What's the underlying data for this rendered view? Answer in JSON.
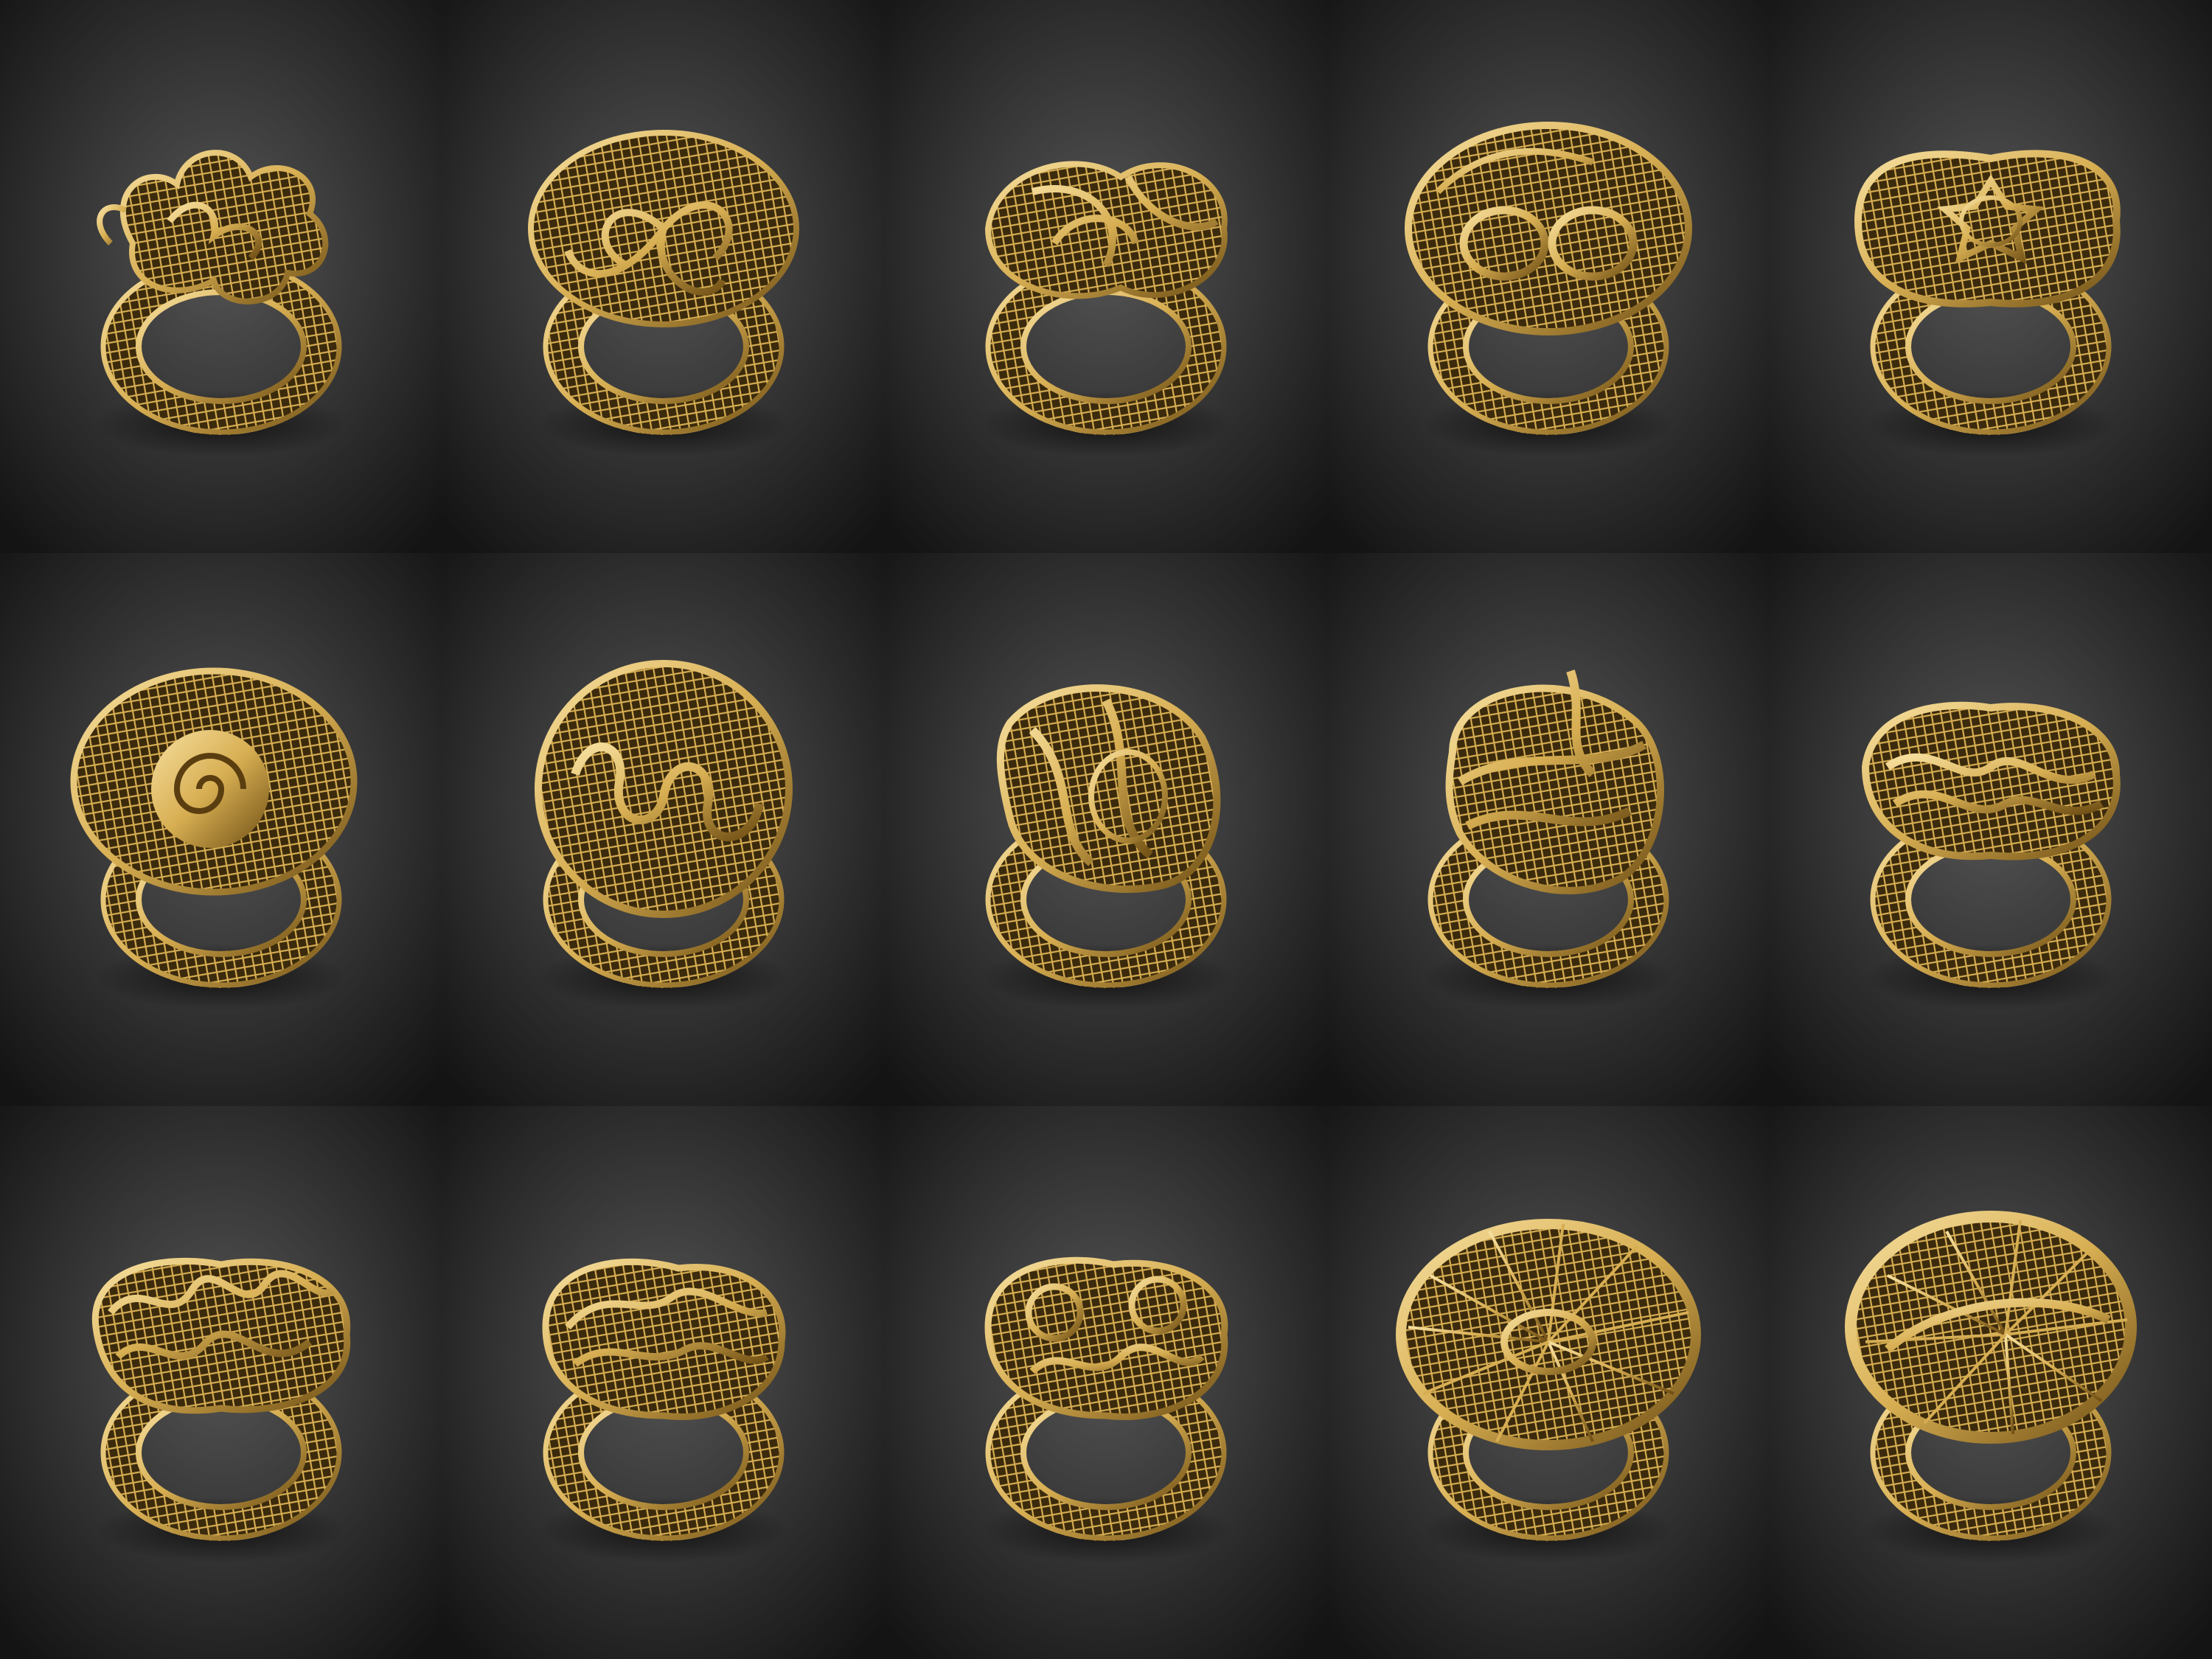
{
  "scene": {
    "background_light": "#555555",
    "background_dark": "#141414",
    "gold_light": "#f7e0a0",
    "gold_mid": "#d7ae52",
    "gold_dark": "#6e4e14"
  },
  "rings": [
    {
      "top_style": "ruffled-flower"
    },
    {
      "top_style": "swirled-flower"
    },
    {
      "top_style": "twisted-petals"
    },
    {
      "top_style": "double-loop-disc"
    },
    {
      "top_style": "star-center-flower"
    },
    {
      "top_style": "spiral-center-disc"
    },
    {
      "top_style": "wavy-ribbon-disc"
    },
    {
      "top_style": "folded-ribbon"
    },
    {
      "top_style": "tall-twisted-ribbon"
    },
    {
      "top_style": "layered-ribbon"
    },
    {
      "top_style": "ruffled-wave"
    },
    {
      "top_style": "scrolled-wave"
    },
    {
      "top_style": "curl-cluster"
    },
    {
      "top_style": "radial-wire-bowl"
    },
    {
      "top_style": "radial-wire-shell"
    }
  ]
}
